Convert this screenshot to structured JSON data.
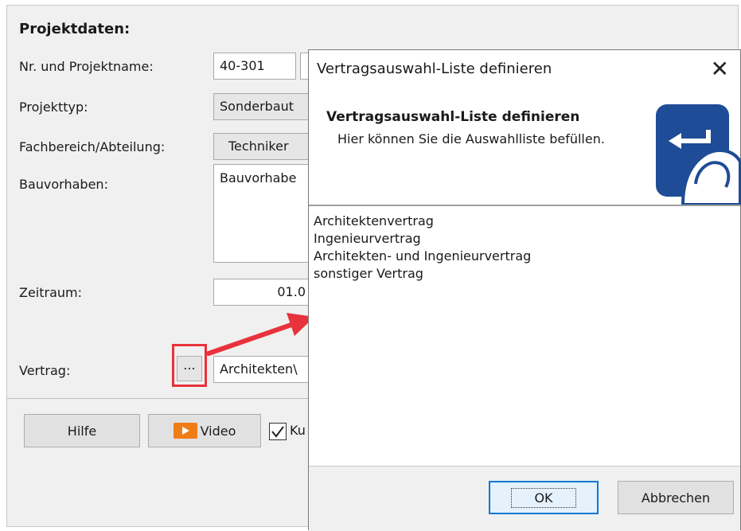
{
  "project": {
    "section_title": "Projektdaten:",
    "labels": {
      "nr_name": "Nr. und Projektname:",
      "typ": "Projekttyp:",
      "fachbereich": "Fachbereich/Abteilung:",
      "bauvorhaben": "Bauvorhaben:",
      "zeitraum": "Zeitraum:",
      "vertrag": "Vertrag:"
    },
    "values": {
      "nr": "40-301",
      "typ": "Sonderbaut",
      "fachbereich": "Techniker",
      "bauvorhaben": "Bauvorhabe",
      "zeitraum": "01.0",
      "vertrag": "Architekten\\"
    },
    "dots_button": "..."
  },
  "bottom_bar": {
    "help": "Hilfe",
    "video": "Video",
    "checkbox_label": "Ku"
  },
  "dialog": {
    "title": "Vertragsauswahl-Liste definieren",
    "close": "✕",
    "header_title": "Vertragsauswahl-Liste definieren",
    "header_subtitle": "Hier können Sie die Auswahlliste befüllen.",
    "list": [
      "Architektenvertrag",
      "Ingenieurvertrag",
      "Architekten- und Ingenieurvertrag",
      "sonstiger Vertrag"
    ],
    "ok": "OK",
    "cancel": "Abbrechen"
  },
  "colors": {
    "highlight": "#e8323c",
    "icon_blue": "#1e4c96",
    "video_orange": "#f07c16",
    "ok_border": "#0078d7"
  },
  "icons": [
    "enter-key-touch-icon",
    "video-icon",
    "close-icon",
    "checkbox-checked-icon"
  ]
}
